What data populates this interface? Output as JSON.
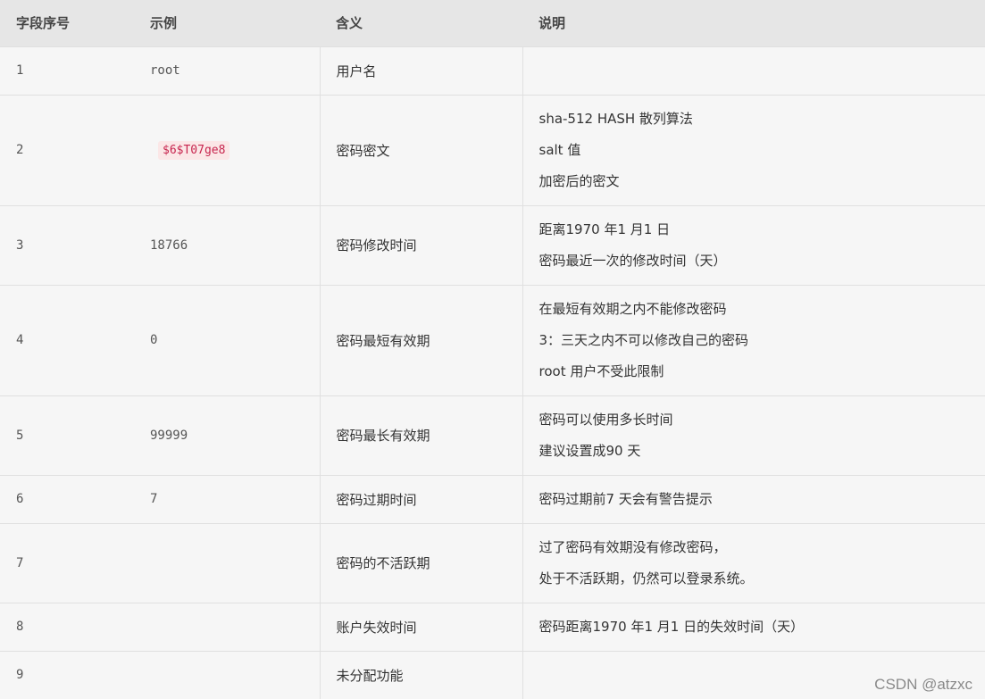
{
  "headers": [
    "字段序号",
    "示例",
    "含义",
    "说明"
  ],
  "rows": [
    {
      "num": "1",
      "example": "root",
      "meaning": "用户名",
      "desc": []
    },
    {
      "num": "2",
      "example": "$6$T07ge8",
      "example_code": true,
      "meaning": "密码密文",
      "desc": [
        "sha-512 HASH 散列算法",
        "salt 值",
        "加密后的密文"
      ]
    },
    {
      "num": "3",
      "example": "18766",
      "meaning": "密码修改时间",
      "desc": [
        "距离1970 年1 月1 日",
        "密码最近一次的修改时间（天）"
      ]
    },
    {
      "num": "4",
      "example": "0",
      "meaning": "密码最短有效期",
      "desc": [
        "在最短有效期之内不能修改密码",
        "3：三天之内不可以修改自己的密码",
        "root 用户不受此限制"
      ]
    },
    {
      "num": "5",
      "example": "99999",
      "meaning": "密码最长有效期",
      "desc": [
        "密码可以使用多长时间",
        "建议设置成90 天"
      ]
    },
    {
      "num": "6",
      "example": "7",
      "meaning": "密码过期时间",
      "desc": [
        "密码过期前7 天会有警告提示"
      ]
    },
    {
      "num": "7",
      "example": "",
      "meaning": "密码的不活跃期",
      "desc": [
        "过了密码有效期没有修改密码，",
        "处于不活跃期，仍然可以登录系统。"
      ]
    },
    {
      "num": "8",
      "example": "",
      "meaning": "账户失效时间",
      "desc": [
        "密码距离1970 年1 月1 日的失效时间（天）"
      ]
    },
    {
      "num": "9",
      "example": "",
      "meaning": "未分配功能",
      "desc": []
    }
  ],
  "watermark": "CSDN @atzxc"
}
